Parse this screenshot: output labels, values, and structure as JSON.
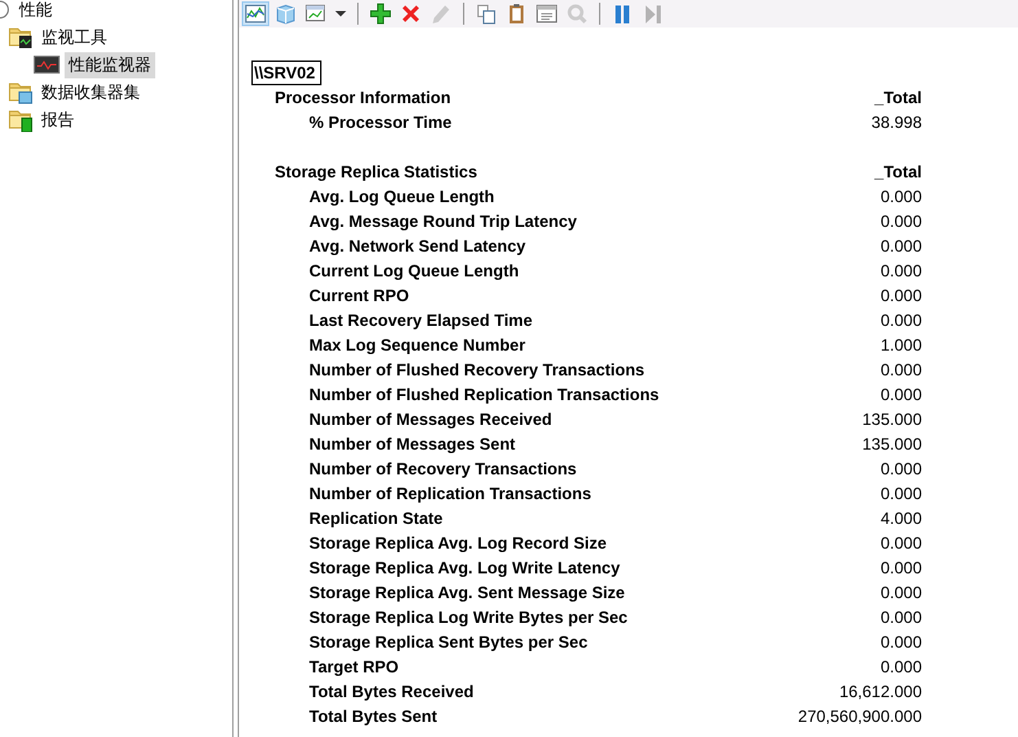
{
  "tree": [
    {
      "label": "性能",
      "kind": "root",
      "selected": false,
      "children": [
        {
          "label": "监视工具",
          "kind": "folder-monitor",
          "selected": false,
          "children": [
            {
              "label": "性能监视器",
              "kind": "monitor",
              "selected": true
            }
          ]
        },
        {
          "label": "数据收集器集",
          "kind": "folder-data",
          "selected": false
        },
        {
          "label": "报告",
          "kind": "folder-report",
          "selected": false
        }
      ]
    }
  ],
  "toolbar": [
    {
      "kind": "graph",
      "selected": true,
      "disabled": false
    },
    {
      "kind": "cube",
      "selected": false,
      "disabled": false
    },
    {
      "kind": "chart-type",
      "selected": false,
      "disabled": false
    },
    {
      "kind": "dropdown",
      "selected": false,
      "disabled": false
    },
    {
      "kind": "separator"
    },
    {
      "kind": "add",
      "selected": false,
      "disabled": false
    },
    {
      "kind": "delete",
      "selected": false,
      "disabled": false
    },
    {
      "kind": "pencil",
      "selected": false,
      "disabled": true
    },
    {
      "kind": "separator"
    },
    {
      "kind": "copy",
      "selected": false,
      "disabled": false
    },
    {
      "kind": "paste",
      "selected": false,
      "disabled": false
    },
    {
      "kind": "properties",
      "selected": false,
      "disabled": false
    },
    {
      "kind": "zoom",
      "selected": false,
      "disabled": true
    },
    {
      "kind": "separator"
    },
    {
      "kind": "pause",
      "selected": false,
      "disabled": false
    },
    {
      "kind": "next",
      "selected": false,
      "disabled": true
    }
  ],
  "report": {
    "machine": "\\\\SRV02",
    "objects": [
      {
        "name": "Processor Information",
        "instance": "_Total",
        "counters": [
          {
            "name": "% Processor Time",
            "value": "38.998"
          }
        ]
      },
      {
        "name": "Storage Replica Statistics",
        "instance": "_Total",
        "counters": [
          {
            "name": "Avg. Log Queue Length",
            "value": "0.000"
          },
          {
            "name": "Avg. Message Round Trip Latency",
            "value": "0.000"
          },
          {
            "name": "Avg. Network Send Latency",
            "value": "0.000"
          },
          {
            "name": "Current Log Queue Length",
            "value": "0.000"
          },
          {
            "name": "Current RPO",
            "value": "0.000"
          },
          {
            "name": "Last Recovery Elapsed Time",
            "value": "0.000"
          },
          {
            "name": "Max Log Sequence Number",
            "value": "1.000"
          },
          {
            "name": "Number of Flushed Recovery Transactions",
            "value": "0.000"
          },
          {
            "name": "Number of Flushed Replication Transactions",
            "value": "0.000"
          },
          {
            "name": "Number of Messages Received",
            "value": "135.000"
          },
          {
            "name": "Number of Messages Sent",
            "value": "135.000"
          },
          {
            "name": "Number of Recovery Transactions",
            "value": "0.000"
          },
          {
            "name": "Number of Replication Transactions",
            "value": "0.000"
          },
          {
            "name": "Replication State",
            "value": "4.000"
          },
          {
            "name": "Storage Replica Avg. Log Record Size",
            "value": "0.000"
          },
          {
            "name": "Storage Replica Avg. Log Write Latency",
            "value": "0.000"
          },
          {
            "name": "Storage Replica Avg. Sent Message Size",
            "value": "0.000"
          },
          {
            "name": "Storage Replica Log Write Bytes per Sec",
            "value": "0.000"
          },
          {
            "name": "Storage Replica Sent Bytes per Sec",
            "value": "0.000"
          },
          {
            "name": "Target RPO",
            "value": "0.000"
          },
          {
            "name": "Total Bytes Received",
            "value": "16,612.000"
          },
          {
            "name": "Total Bytes Sent",
            "value": "270,560,900.000"
          }
        ]
      }
    ]
  }
}
